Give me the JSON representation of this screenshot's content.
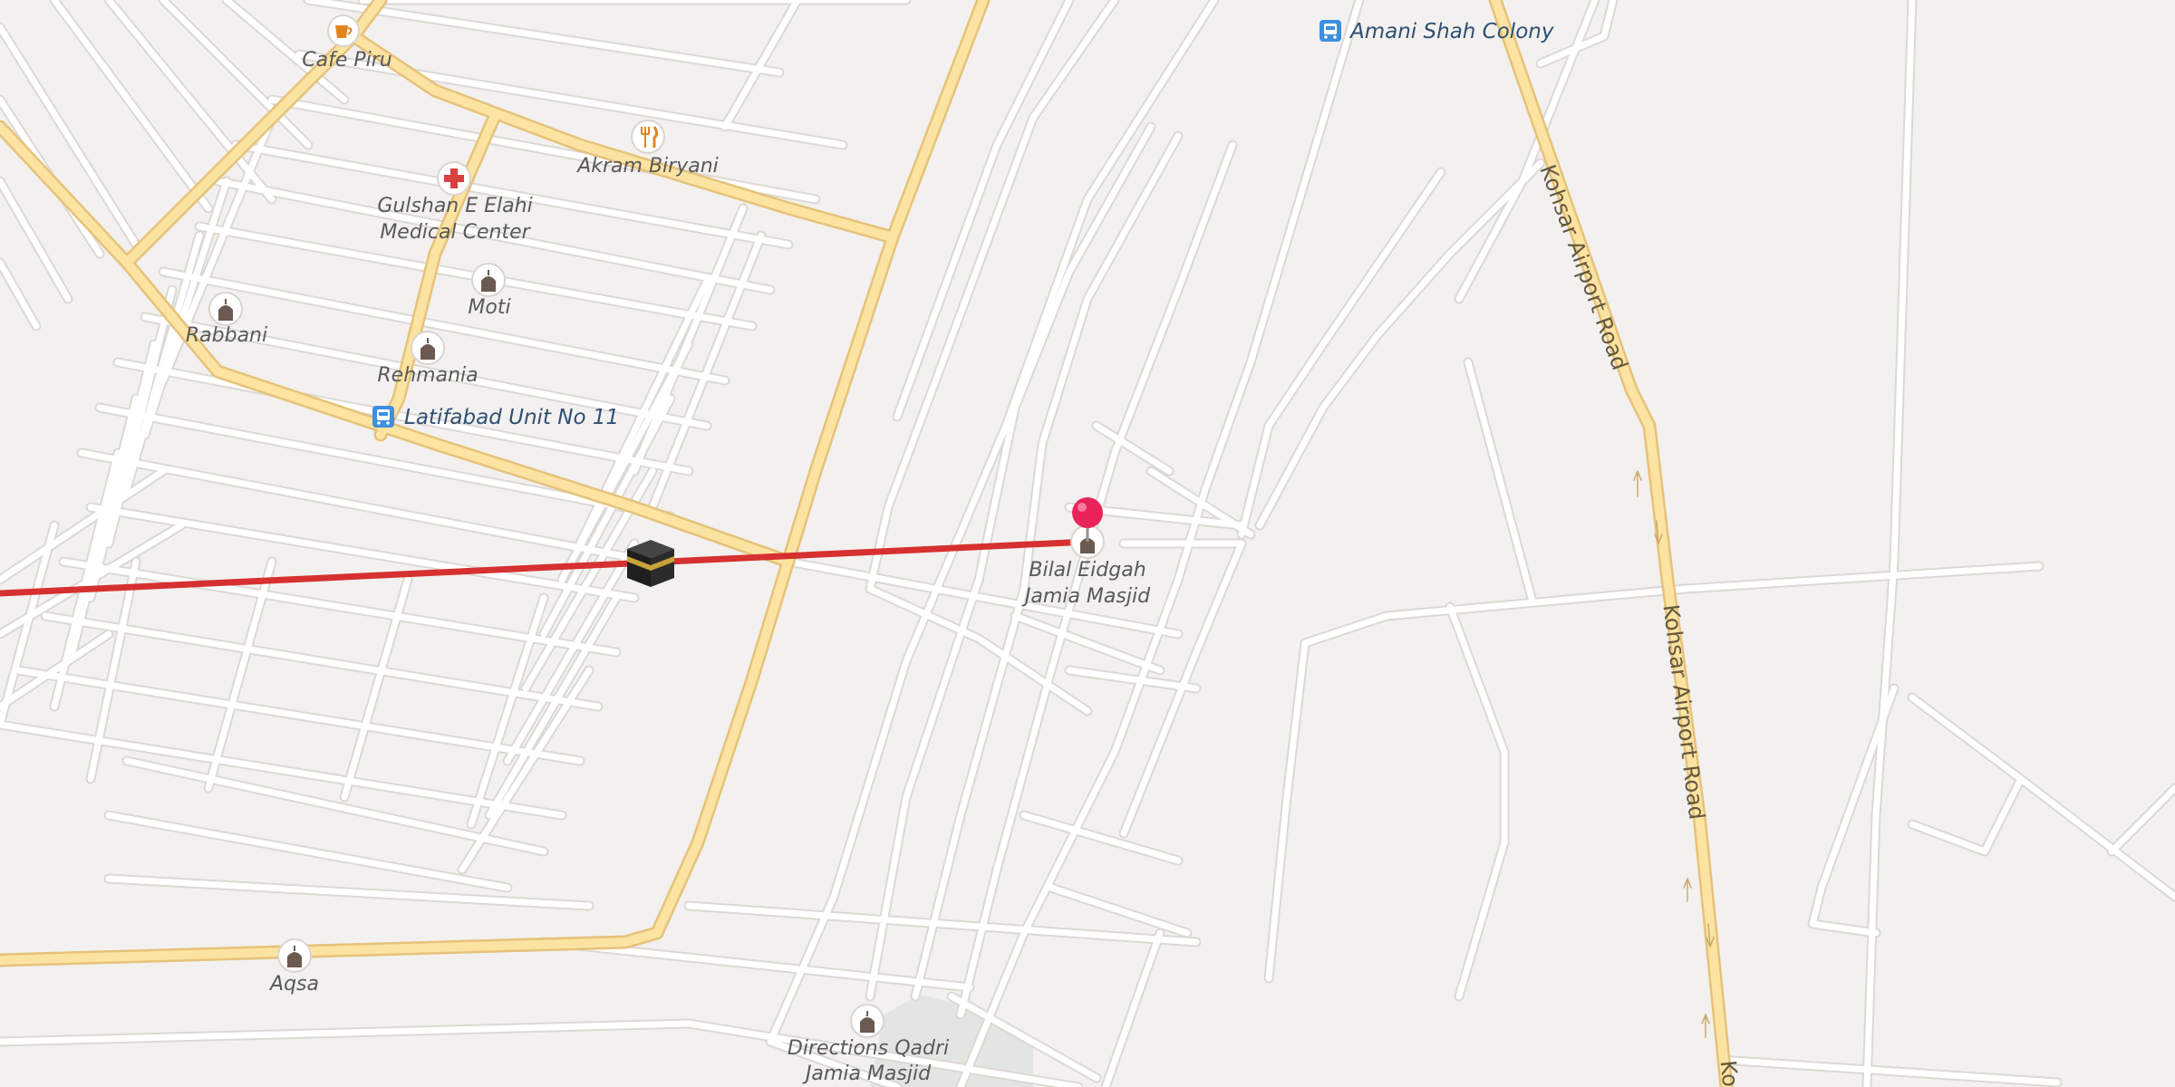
{
  "map": {
    "colors": {
      "land": "#f3f1ef",
      "minor_road": "#ffffff",
      "minor_road_casing": "#dcd8d4",
      "major_road": "#fde3a1",
      "major_road_casing": "#e6c27a",
      "park": "#e3e6e0",
      "qibla_line": "#d63030",
      "pin": "#e8245b",
      "transit": "#3d8fe0",
      "poi_icon": "#6b5a50",
      "hospital": "#d94040",
      "food": "#e0851d"
    },
    "roads": [
      {
        "name": "Kohsar Airport Road",
        "label_top": "Kohsar Airport Road",
        "label_bottom": "Kohsar Airport Road",
        "label_corner": "Ko"
      }
    ],
    "pois": [
      {
        "id": "cafe-piru",
        "name": "Cafe Piru",
        "icon": "coffee-cup-icon"
      },
      {
        "id": "akram-biryani",
        "name": "Akram Biryani",
        "icon": "fork-knife-icon"
      },
      {
        "id": "gulshan-medical",
        "name_line1": "Gulshan E Elahi",
        "name_line2": "Medical Center",
        "icon": "medical-cross-icon"
      },
      {
        "id": "moti",
        "name": "Moti",
        "icon": "mosque-icon"
      },
      {
        "id": "rabbani",
        "name": "Rabbani",
        "icon": "mosque-icon"
      },
      {
        "id": "rehmania",
        "name": "Rehmania",
        "icon": "mosque-icon"
      },
      {
        "id": "bilal-eidgah",
        "name_line1": "Bilal Eidgah",
        "name_line2": "Jamia Masjid",
        "icon": "mosque-icon"
      },
      {
        "id": "aqsa",
        "name": "Aqsa",
        "icon": "mosque-icon"
      },
      {
        "id": "qadri",
        "name_line1": "Directions Qadri",
        "name_line2": "Jamia Masjid",
        "icon": "mosque-icon"
      }
    ],
    "transit": [
      {
        "id": "amani-shah",
        "name": "Amani Shah Colony",
        "icon": "bus-stop-icon"
      },
      {
        "id": "latifabad",
        "name": "Latifabad Unit No 11",
        "icon": "bus-stop-icon"
      }
    ],
    "markers": {
      "selected_pin": "location-pin-icon",
      "kaaba": "kaaba-icon"
    }
  }
}
